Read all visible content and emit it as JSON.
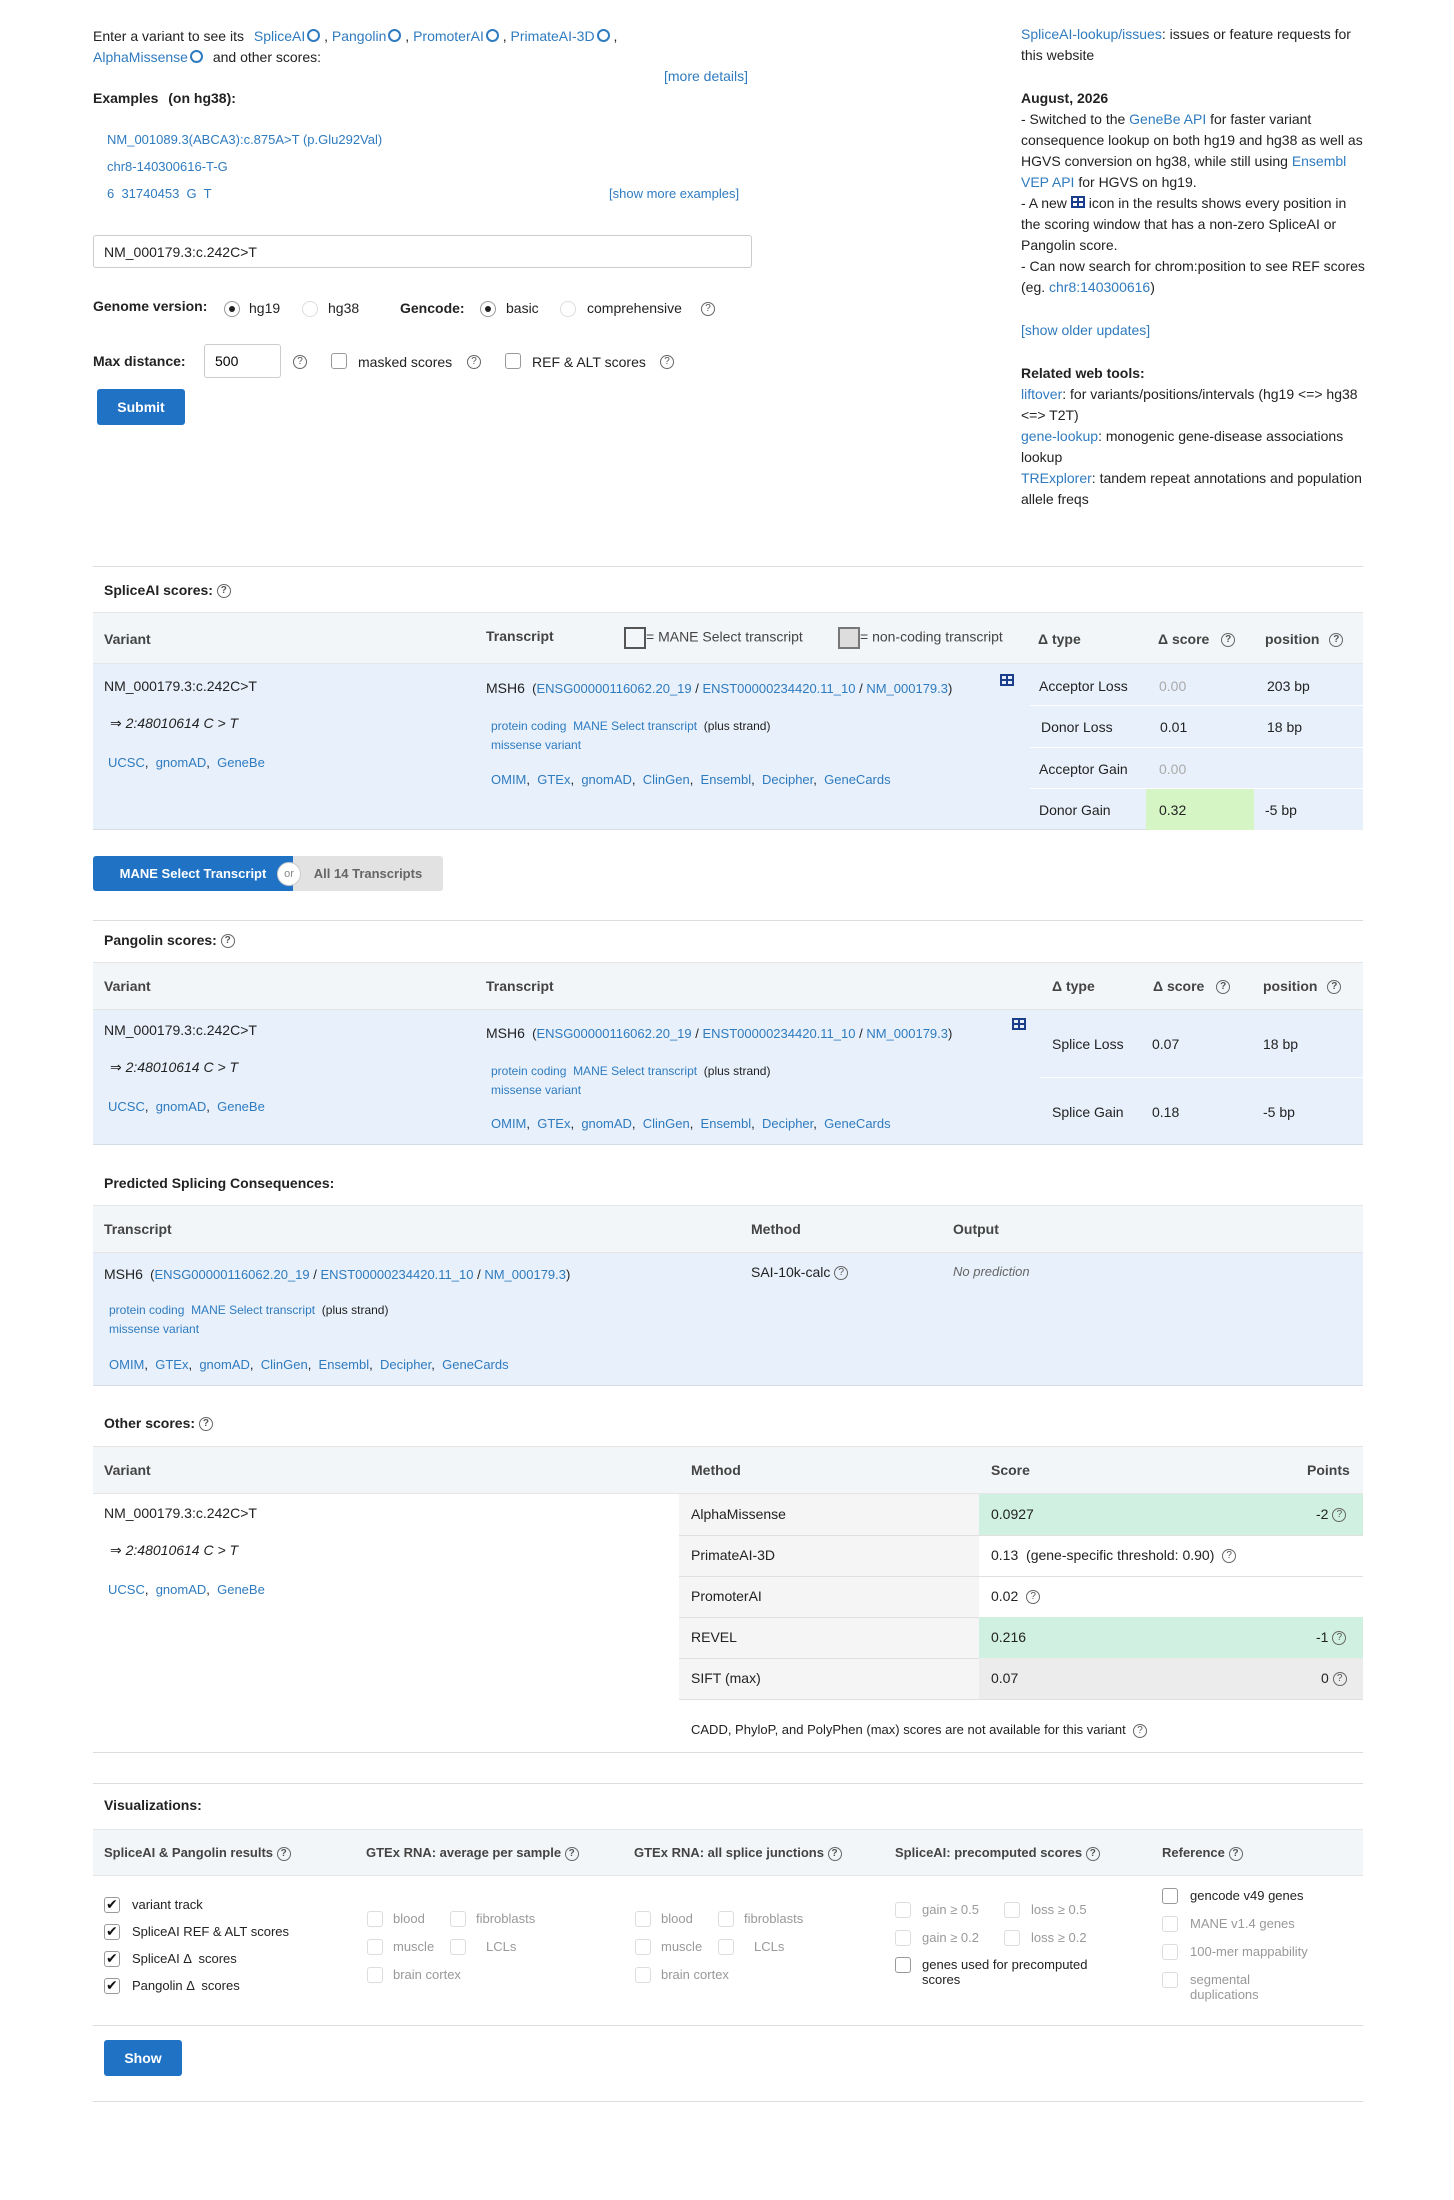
{
  "intro": {
    "prefix": "Enter a variant to see its",
    "tools": [
      "SpliceAI",
      "Pangolin",
      "PromoterAI",
      "PrimateAI-3D",
      "AlphaMissense"
    ],
    "suffix": "and other scores:",
    "more_details": "[more details]"
  },
  "examples": {
    "heading": "Examples",
    "subheading": "(on hg38):",
    "items": [
      "NM_001089.3(ABCA3):c.875A>T (p.Glu292Val)",
      "chr8-140300616-T-G",
      "6  31740453  G  T"
    ],
    "show_more": "[show more examples]"
  },
  "search": {
    "value": "NM_000179.3:c.242C>T"
  },
  "options": {
    "genome_label": "Genome version:",
    "genome_options": [
      "hg19",
      "hg38"
    ],
    "gencode_label": "Gencode:",
    "gencode_options": [
      "basic",
      "comprehensive"
    ],
    "max_distance_label": "Max distance:",
    "max_distance_value": "500",
    "masked_label": "masked scores",
    "refalt_label": "REF & ALT scores",
    "submit": "Submit"
  },
  "news": {
    "issues_link": "SpliceAI-lookup/issues",
    "issues_text": ": issues or feature requests for this website",
    "date": "August, 2026",
    "u1a": "- Switched to the ",
    "u1link": "GeneBe API",
    "u1b": " for faster variant consequence lookup on both hg19 and hg38 as well as HGVS conversion on hg38, while still using ",
    "u1link2": "Ensembl VEP API",
    "u1c": " for HGVS on hg19.",
    "u2a": "- A new ",
    "u2b": " icon in the results shows every position in the scoring window that has a non-zero SpliceAI or Pangolin score.",
    "u3a": "- Can now search for chrom:position to see REF scores (eg. ",
    "u3link": "chr8:140300616",
    "u3b": ")",
    "older": "[show older updates]",
    "related_heading": "Related web tools:",
    "tools": [
      {
        "name": "liftover",
        "desc": ": for variants/positions/intervals (hg19 <=> hg38 <=> T2T)"
      },
      {
        "name": "gene-lookup",
        "desc": ": monogenic gene-disease associations lookup"
      },
      {
        "name": "TRExplorer",
        "desc": ": tandem repeat annotations and population allele freqs"
      }
    ]
  },
  "variant": {
    "name": "NM_000179.3:c.242C>T",
    "coord": "⇒ 2:48010614 C > T",
    "links": [
      "UCSC",
      "gnomAD",
      "GeneBe"
    ]
  },
  "transcript": {
    "gene": "MSH6",
    "ids": [
      "ENSG00000116062.20_19",
      "ENST00000234420.11_10",
      "NM_000179.3"
    ],
    "biotype": "protein coding",
    "mane": "MANE Select transcript",
    "strand": "(plus strand)",
    "consequence": "missense variant",
    "db_links": [
      "OMIM",
      "GTEx",
      "gnomAD",
      "ClinGen",
      "Ensembl",
      "Decipher",
      "GeneCards"
    ]
  },
  "spliceai": {
    "title": "SpliceAI scores:",
    "headers": {
      "variant": "Variant",
      "transcript": "Transcript",
      "mane_legend": "= MANE Select transcript",
      "noncoding_legend": "= non-coding transcript",
      "type": "Δ type",
      "score": "Δ score",
      "position": "position"
    },
    "rows": [
      {
        "type": "Acceptor Loss",
        "score": "0.00",
        "position": "203 bp"
      },
      {
        "type": "Donor Loss",
        "score": "0.01",
        "position": "18 bp"
      },
      {
        "type": "Acceptor Gain",
        "score": "0.00",
        "position": ""
      },
      {
        "type": "Donor Gain",
        "score": "0.32",
        "position": "-5 bp"
      }
    ]
  },
  "toggle": {
    "left": "MANE Select Transcript",
    "or": "or",
    "right": "All 14 Transcripts"
  },
  "pangolin": {
    "title": "Pangolin scores:",
    "rows": [
      {
        "type": "Splice Loss",
        "score": "0.07",
        "position": "18 bp"
      },
      {
        "type": "Splice Gain",
        "score": "0.18",
        "position": "-5 bp"
      }
    ]
  },
  "consequences": {
    "title": "Predicted Splicing Consequences:",
    "headers": {
      "transcript": "Transcript",
      "method": "Method",
      "output": "Output"
    },
    "method": "SAI-10k-calc",
    "output": "No prediction"
  },
  "other": {
    "title": "Other scores:",
    "headers": {
      "variant": "Variant",
      "method": "Method",
      "score": "Score",
      "points": "Points"
    },
    "rows": [
      {
        "method": "AlphaMissense",
        "score": "0.0927",
        "points": "-2"
      },
      {
        "method": "PrimateAI-3D",
        "score": "0.13  (gene-specific threshold: 0.90)",
        "points": ""
      },
      {
        "method": "PromoterAI",
        "score": "0.02",
        "points": ""
      },
      {
        "method": "REVEL",
        "score": "0.216",
        "points": "-1"
      },
      {
        "method": "SIFT (max)",
        "score": "0.07",
        "points": "0"
      }
    ],
    "note": "CADD, PhyloP, and PolyPhen (max) scores are not available for this variant"
  },
  "viz": {
    "title": "Visualizations:",
    "cols": [
      {
        "title": "SpliceAI & Pangolin results",
        "items": [
          "variant track",
          "SpliceAI REF & ALT scores",
          "SpliceAI Δ  scores",
          "Pangolin Δ  scores"
        ]
      },
      {
        "title": "GTEx RNA: average per sample",
        "items": [
          "blood",
          "fibroblasts",
          "muscle",
          "LCLs",
          "brain cortex"
        ]
      },
      {
        "title": "GTEx RNA: all splice junctions",
        "items": [
          "blood",
          "fibroblasts",
          "muscle",
          "LCLs",
          "brain cortex"
        ]
      },
      {
        "title": "SpliceAI: precomputed scores",
        "items": [
          "gain ≥ 0.5",
          "loss ≥ 0.5",
          "gain ≥ 0.2",
          "loss ≥ 0.2",
          "genes used for precomputed scores"
        ]
      },
      {
        "title": "Reference",
        "items": [
          "gencode v49 genes",
          "MANE v1.4 genes",
          "100-mer mappability",
          "segmental duplications"
        ]
      }
    ],
    "show": "Show"
  }
}
